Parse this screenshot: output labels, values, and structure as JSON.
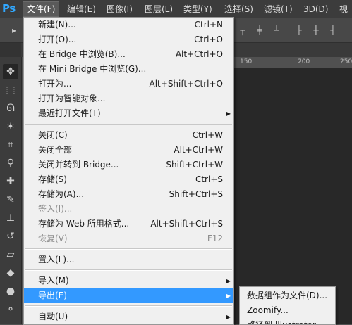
{
  "app": {
    "logo": "Ps"
  },
  "menubar": {
    "items": [
      {
        "label": "文件(F)"
      },
      {
        "label": "编辑(E)"
      },
      {
        "label": "图像(I)"
      },
      {
        "label": "图层(L)"
      },
      {
        "label": "类型(Y)"
      },
      {
        "label": "选择(S)"
      },
      {
        "label": "滤镜(T)"
      },
      {
        "label": "3D(D)"
      },
      {
        "label": "视"
      }
    ],
    "active_index": 0
  },
  "ruler": {
    "ticks": [
      "150",
      "200",
      "250"
    ]
  },
  "file_menu": {
    "items": [
      {
        "label": "新建(N)...",
        "shortcut": "Ctrl+N"
      },
      {
        "label": "打开(O)...",
        "shortcut": "Ctrl+O"
      },
      {
        "label": "在 Bridge 中浏览(B)...",
        "shortcut": "Alt+Ctrl+O"
      },
      {
        "label": "在 Mini Bridge 中浏览(G)...",
        "shortcut": ""
      },
      {
        "label": "打开为...",
        "shortcut": "Alt+Shift+Ctrl+O"
      },
      {
        "label": "打开为智能对象...",
        "shortcut": ""
      },
      {
        "label": "最近打开文件(T)",
        "shortcut": "",
        "submenu": true
      },
      {
        "label": "关闭(C)",
        "shortcut": "Ctrl+W"
      },
      {
        "label": "关闭全部",
        "shortcut": "Alt+Ctrl+W"
      },
      {
        "label": "关闭并转到 Bridge...",
        "shortcut": "Shift+Ctrl+W"
      },
      {
        "label": "存储(S)",
        "shortcut": "Ctrl+S"
      },
      {
        "label": "存储为(A)...",
        "shortcut": "Shift+Ctrl+S"
      },
      {
        "label": "签入(I)...",
        "shortcut": "",
        "disabled": true
      },
      {
        "label": "存储为 Web 所用格式...",
        "shortcut": "Alt+Shift+Ctrl+S"
      },
      {
        "label": "恢复(V)",
        "shortcut": "F12",
        "disabled": true
      },
      {
        "label": "置入(L)...",
        "shortcut": ""
      },
      {
        "label": "导入(M)",
        "shortcut": "",
        "submenu": true
      },
      {
        "label": "导出(E)",
        "shortcut": "",
        "submenu": true,
        "highlighted": true
      },
      {
        "label": "自动(U)",
        "shortcut": "",
        "submenu": true
      }
    ]
  },
  "export_submenu": {
    "items": [
      {
        "label": "数据组作为文件(D)..."
      },
      {
        "label": "Zoomify..."
      },
      {
        "label": "路径到 Illustrator..."
      }
    ]
  },
  "colors": {
    "highlight": "#3399ff",
    "menu_bg": "#f0f0f0",
    "app_bg": "#535353"
  }
}
